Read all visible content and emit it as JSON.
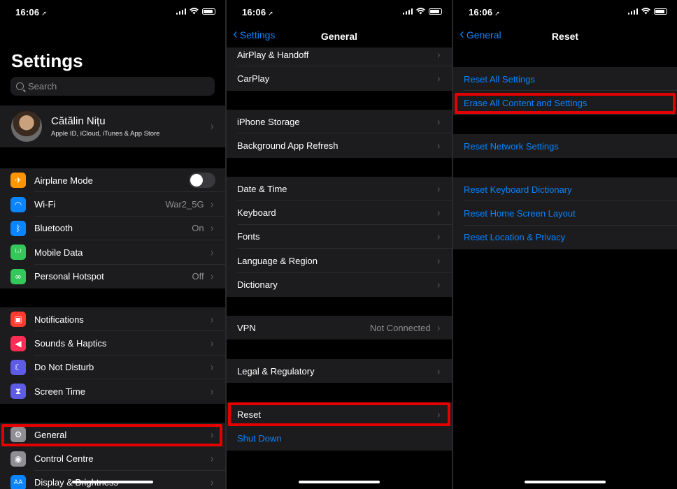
{
  "status": {
    "time": "16:06",
    "loc_icon": "➚"
  },
  "settings": {
    "title": "Settings",
    "search_placeholder": "Search",
    "profile": {
      "name": "Cătălin Nițu",
      "sub": "Apple ID, iCloud, iTunes & App Store"
    },
    "group1": [
      {
        "label": "Airplane Mode",
        "icon": "airplane-icon",
        "glyph": "✈",
        "color": "#ff9500",
        "toggle": true
      },
      {
        "label": "Wi-Fi",
        "icon": "wifi-icon",
        "glyph": "◠",
        "color": "#0a84ff",
        "value": "War2_5G"
      },
      {
        "label": "Bluetooth",
        "icon": "bluetooth-icon",
        "glyph": "ᛒ",
        "color": "#0a84ff",
        "value": "On"
      },
      {
        "label": "Mobile Data",
        "icon": "antenna-icon",
        "glyph": "⁽·⁾",
        "color": "#34c759",
        "value": ""
      },
      {
        "label": "Personal Hotspot",
        "icon": "hotspot-icon",
        "glyph": "∞",
        "color": "#34c759",
        "value": "Off"
      }
    ],
    "group2": [
      {
        "label": "Notifications",
        "icon": "notifications-icon",
        "glyph": "▣",
        "color": "#ff3b30"
      },
      {
        "label": "Sounds & Haptics",
        "icon": "speaker-icon",
        "glyph": "◀",
        "color": "#ff2d55"
      },
      {
        "label": "Do Not Disturb",
        "icon": "moon-icon",
        "glyph": "☾",
        "color": "#5e5ce6"
      },
      {
        "label": "Screen Time",
        "icon": "hourglass-icon",
        "glyph": "⧗",
        "color": "#5e5ce6"
      }
    ],
    "group3": [
      {
        "label": "General",
        "icon": "gear-icon",
        "glyph": "⚙",
        "color": "#8e8e93"
      },
      {
        "label": "Control Centre",
        "icon": "control-centre-icon",
        "glyph": "◉",
        "color": "#8e8e93"
      },
      {
        "label": "Display & Brightness",
        "icon": "display-icon",
        "glyph": "AA",
        "color": "#0a84ff"
      }
    ]
  },
  "general": {
    "back": "Settings",
    "title": "General",
    "group1": [
      {
        "label": "AirPlay & Handoff"
      },
      {
        "label": "CarPlay"
      }
    ],
    "group2": [
      {
        "label": "iPhone Storage"
      },
      {
        "label": "Background App Refresh"
      }
    ],
    "group3": [
      {
        "label": "Date & Time"
      },
      {
        "label": "Keyboard"
      },
      {
        "label": "Fonts"
      },
      {
        "label": "Language & Region"
      },
      {
        "label": "Dictionary"
      }
    ],
    "group4": [
      {
        "label": "VPN",
        "value": "Not Connected"
      }
    ],
    "group5": [
      {
        "label": "Legal & Regulatory"
      }
    ],
    "group6": [
      {
        "label": "Reset"
      },
      {
        "label": "Shut Down"
      }
    ]
  },
  "reset": {
    "back": "General",
    "title": "Reset",
    "group1": [
      "Reset All Settings",
      "Erase All Content and Settings"
    ],
    "group2": [
      "Reset Network Settings"
    ],
    "group3": [
      "Reset Keyboard Dictionary",
      "Reset Home Screen Layout",
      "Reset Location & Privacy"
    ]
  },
  "colors": {
    "highlight": "#e40000",
    "link": "#0a84ff",
    "cell": "#1c1c1e"
  }
}
